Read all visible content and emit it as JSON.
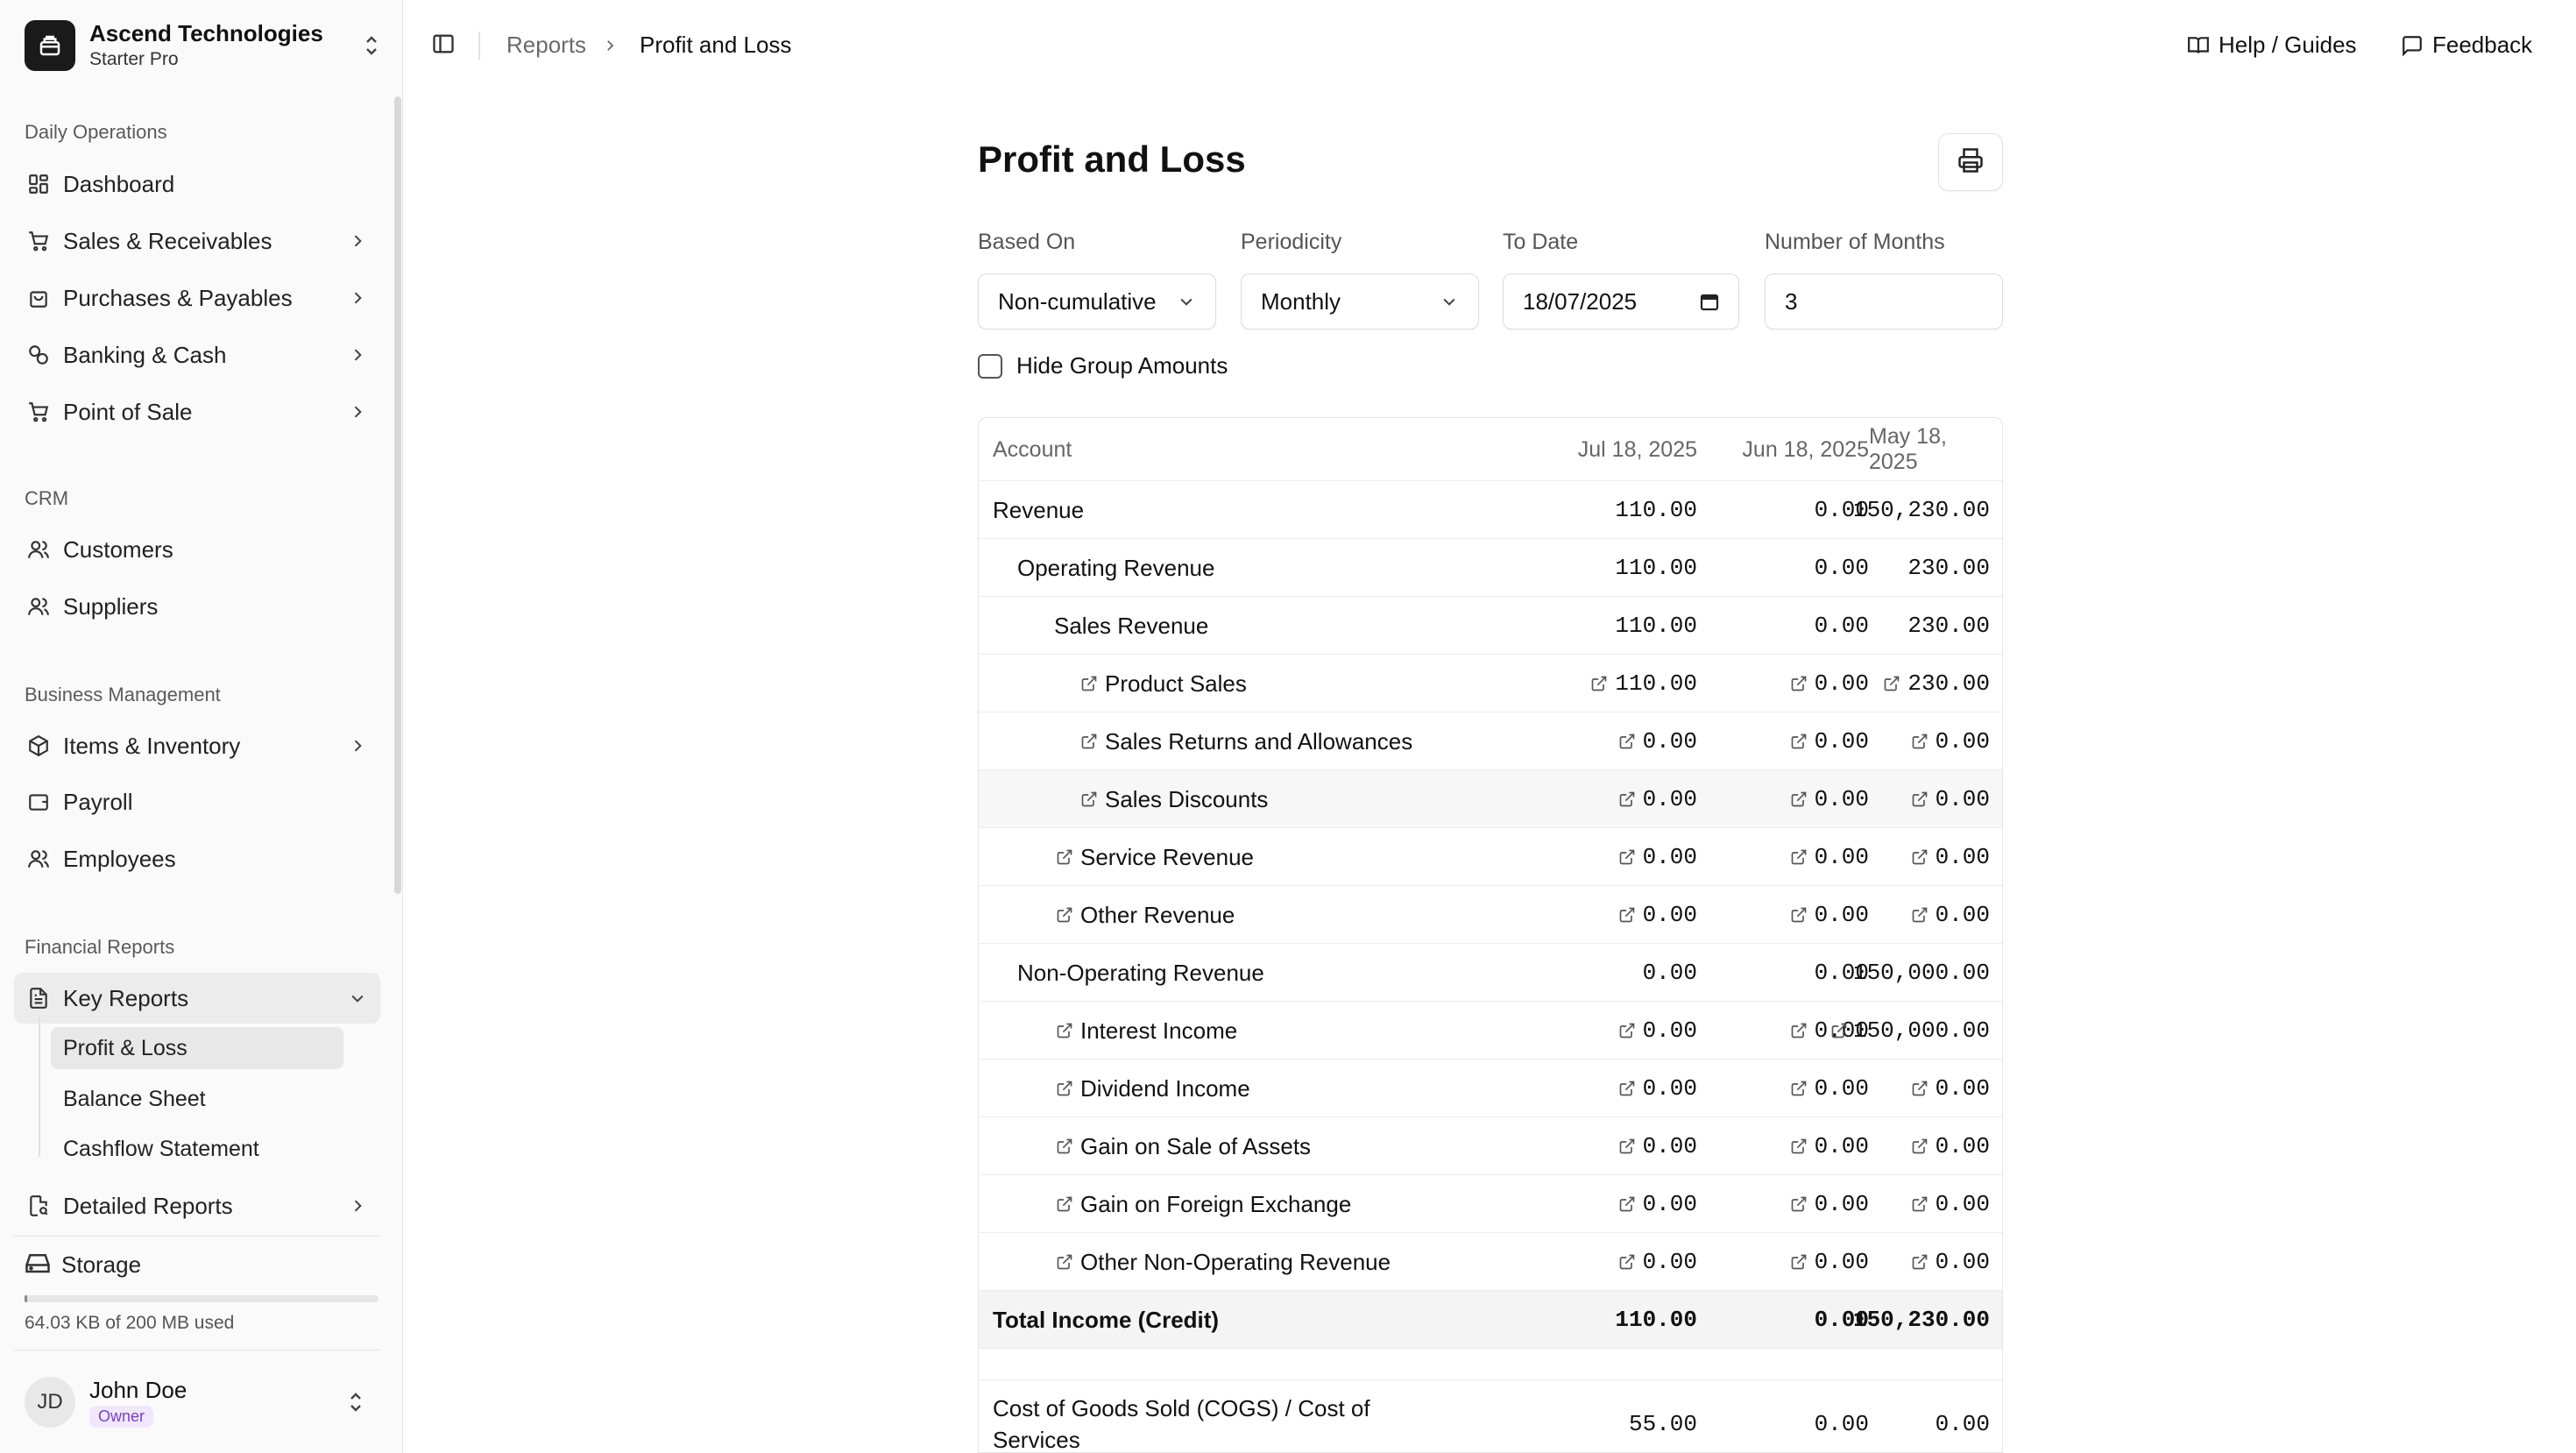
{
  "org": {
    "name": "Ascend Technologies",
    "plan": "Starter Pro"
  },
  "sidebar": {
    "sections": [
      {
        "title": "Daily Operations"
      },
      {
        "title": "CRM"
      },
      {
        "title": "Business Management"
      },
      {
        "title": "Financial Reports"
      }
    ],
    "items": {
      "dashboard": "Dashboard",
      "sales": "Sales & Receivables",
      "purchases": "Purchases & Payables",
      "banking": "Banking & Cash",
      "pos": "Point of Sale",
      "customers": "Customers",
      "suppliers": "Suppliers",
      "items": "Items & Inventory",
      "payroll": "Payroll",
      "employees": "Employees",
      "key_reports": "Key Reports",
      "profit_loss": "Profit & Loss",
      "balance_sheet": "Balance Sheet",
      "cashflow": "Cashflow Statement",
      "detailed_reports": "Detailed Reports"
    },
    "storage": {
      "label": "Storage",
      "used": "64.03 KB of 200 MB used"
    },
    "user": {
      "name": "John Doe",
      "initials": "JD",
      "role": "Owner"
    }
  },
  "topbar": {
    "breadcrumb": [
      "Reports",
      "Profit and Loss"
    ],
    "help": "Help / Guides",
    "feedback": "Feedback"
  },
  "page": {
    "title": "Profit and Loss",
    "filters": {
      "based_on": {
        "label": "Based On",
        "value": "Non-cumulative"
      },
      "periodicity": {
        "label": "Periodicity",
        "value": "Monthly"
      },
      "to_date": {
        "label": "To Date",
        "value": "18/07/2025"
      },
      "months": {
        "label": "Number of Months",
        "value": "3"
      }
    },
    "hide_group": "Hide Group Amounts"
  },
  "table": {
    "headers": [
      "Account",
      "Jul 18, 2025",
      "Jun 18, 2025",
      "May 18, 2025"
    ],
    "rows": [
      {
        "account": "Revenue",
        "values": [
          "110.00",
          "0.00",
          "150,230.00"
        ]
      },
      {
        "account": "Operating Revenue",
        "values": [
          "110.00",
          "0.00",
          "230.00"
        ]
      },
      {
        "account": "Sales Revenue",
        "values": [
          "110.00",
          "0.00",
          "230.00"
        ]
      },
      {
        "account": "Product Sales",
        "values": [
          "110.00",
          "0.00",
          "230.00"
        ]
      },
      {
        "account": "Sales Returns and Allowances",
        "values": [
          "0.00",
          "0.00",
          "0.00"
        ]
      },
      {
        "account": "Sales Discounts",
        "values": [
          "0.00",
          "0.00",
          "0.00"
        ]
      },
      {
        "account": "Service Revenue",
        "values": [
          "0.00",
          "0.00",
          "0.00"
        ]
      },
      {
        "account": "Other Revenue",
        "values": [
          "0.00",
          "0.00",
          "0.00"
        ]
      },
      {
        "account": "Non-Operating Revenue",
        "values": [
          "0.00",
          "0.00",
          "150,000.00"
        ]
      },
      {
        "account": "Interest Income",
        "values": [
          "0.00",
          "0.00",
          "150,000.00"
        ]
      },
      {
        "account": "Dividend Income",
        "values": [
          "0.00",
          "0.00",
          "0.00"
        ]
      },
      {
        "account": "Gain on Sale of Assets",
        "values": [
          "0.00",
          "0.00",
          "0.00"
        ]
      },
      {
        "account": "Gain on Foreign Exchange",
        "values": [
          "0.00",
          "0.00",
          "0.00"
        ]
      },
      {
        "account": "Other Non-Operating Revenue",
        "values": [
          "0.00",
          "0.00",
          "0.00"
        ]
      },
      {
        "account": "Total Income (Credit)",
        "values": [
          "110.00",
          "0.00",
          "150,230.00"
        ]
      },
      {
        "account": "Cost of Goods Sold (COGS) / Cost of Services",
        "values": [
          "55.00",
          "0.00",
          "0.00"
        ]
      }
    ]
  }
}
